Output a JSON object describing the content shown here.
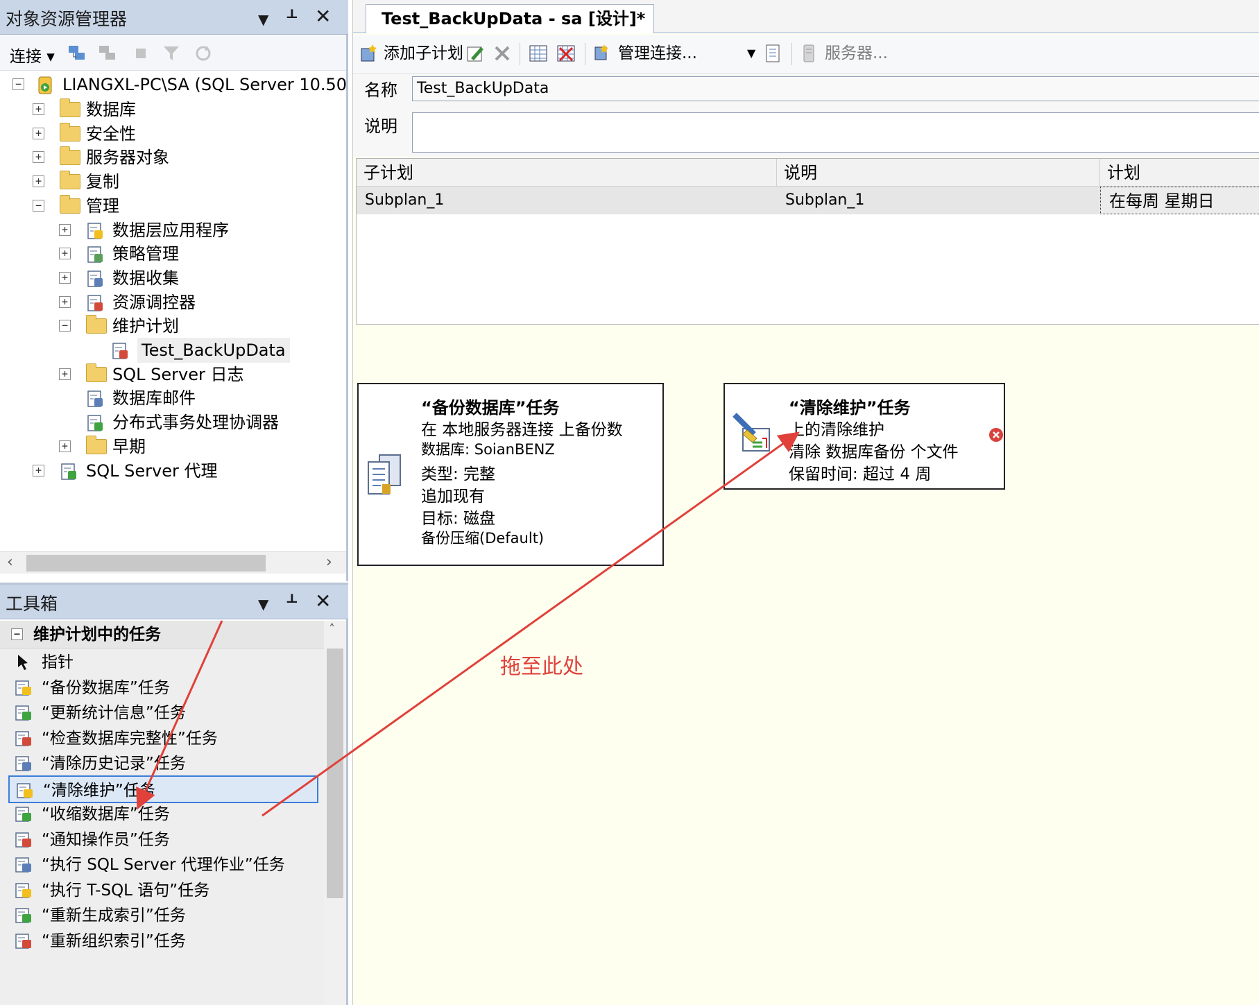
{
  "object_explorer": {
    "title": "对象资源管理器",
    "connect_label": "连接",
    "server_node": "LIANGXL-PC\\SA (SQL Server 10.50.",
    "tree": [
      {
        "label": "数据库",
        "level": 1,
        "expander": "+",
        "icon": "folder-icon"
      },
      {
        "label": "安全性",
        "level": 1,
        "expander": "+",
        "icon": "folder-icon"
      },
      {
        "label": "服务器对象",
        "level": 1,
        "expander": "+",
        "icon": "folder-icon"
      },
      {
        "label": "复制",
        "level": 1,
        "expander": "+",
        "icon": "folder-icon"
      },
      {
        "label": "管理",
        "level": 1,
        "expander": "−",
        "icon": "folder-icon"
      },
      {
        "label": "数据层应用程序",
        "level": 2,
        "expander": "+",
        "icon": "data-tier-app-icon"
      },
      {
        "label": "策略管理",
        "level": 2,
        "expander": "+",
        "icon": "policy-management-icon"
      },
      {
        "label": "数据收集",
        "level": 2,
        "expander": "+",
        "icon": "data-collection-icon"
      },
      {
        "label": "资源调控器",
        "level": 2,
        "expander": "+",
        "icon": "resource-governor-icon"
      },
      {
        "label": "维护计划",
        "level": 2,
        "expander": "−",
        "icon": "folder-icon"
      },
      {
        "label": "Test_BackUpData",
        "level": 3,
        "expander": "",
        "icon": "maintenance-plan-icon"
      },
      {
        "label": "SQL Server 日志",
        "level": 2,
        "expander": "+",
        "icon": "folder-icon"
      },
      {
        "label": "数据库邮件",
        "level": 2,
        "expander": "",
        "icon": "database-mail-icon"
      },
      {
        "label": "分布式事务处理协调器",
        "level": 2,
        "expander": "",
        "icon": "dtc-icon"
      },
      {
        "label": "早期",
        "level": 2,
        "expander": "+",
        "icon": "folder-icon"
      },
      {
        "label": "SQL Server 代理",
        "level": 1,
        "expander": "+",
        "icon": "sql-agent-icon"
      }
    ]
  },
  "toolbox": {
    "title": "工具箱",
    "group": "维护计划中的任务",
    "items": [
      "指针",
      "“备份数据库”任务",
      "“更新统计信息”任务",
      "“检查数据库完整性”任务",
      "“清除历史记录”任务",
      "“清除维护”任务",
      "“收缩数据库”任务",
      "“通知操作员”任务",
      "“执行 SQL Server 代理作业”任务",
      "“执行 T-SQL 语句”任务",
      "“重新生成索引”任务",
      "“重新组织索引”任务"
    ],
    "selected_index": 5
  },
  "designer": {
    "tab": "Test_BackUpData - sa [设计]*",
    "toolbar": {
      "add_subplan": "添加子计划",
      "manage_connections": "管理连接...",
      "servers": "服务器..."
    },
    "name_label": "名称",
    "name_value": "Test_BackUpData",
    "desc_label": "说明",
    "desc_value": "",
    "grid": {
      "headers": [
        "子计划",
        "说明",
        "计划"
      ],
      "rows": [
        [
          "Subplan_1",
          "Subplan_1",
          "在每周 星期日"
        ]
      ]
    },
    "tasks": [
      {
        "title": "“备份数据库”任务",
        "lines": [
          "在 本地服务器连接 上备份数",
          "数据库: SoianBENZ",
          "类型: 完整",
          "追加现有",
          "目标: 磁盘",
          "备份压缩(Default)"
        ]
      },
      {
        "title": "“清除维护”任务",
        "lines": [
          "上的清除维护",
          "清除 数据库备份 个文件",
          "保留时间: 超过 4 周"
        ]
      }
    ],
    "annotation": "拖至此处"
  },
  "colors": {
    "panel_title": "#c9d6e8",
    "canvas": "#fffff0",
    "arrow": "#e0413a",
    "selection_border": "#3b7dd8"
  }
}
